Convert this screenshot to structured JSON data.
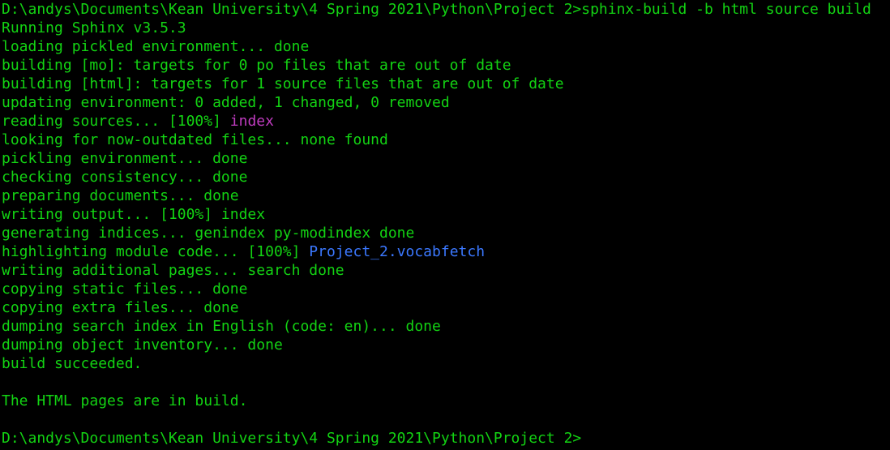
{
  "colors": {
    "background": "#000000",
    "text": "#13d313",
    "magenta": "#c03cc0",
    "blue": "#3b78ff"
  },
  "lines": [
    [
      {
        "text": "D:\\andys\\Documents\\Kean University\\4 Spring 2021\\Python\\Project 2>sphinx-build -b html source build"
      }
    ],
    [
      {
        "text": "Running Sphinx v3.5.3"
      }
    ],
    [
      {
        "text": "loading pickled environment... done"
      }
    ],
    [
      {
        "text": "building [mo]: targets for 0 po files that are out of date"
      }
    ],
    [
      {
        "text": "building [html]: targets for 1 source files that are out of date"
      }
    ],
    [
      {
        "text": "updating environment: 0 added, 1 changed, 0 removed"
      }
    ],
    [
      {
        "text": "reading sources... [100%] "
      },
      {
        "text": "index",
        "color": "magenta"
      }
    ],
    [
      {
        "text": "looking for now-outdated files... none found"
      }
    ],
    [
      {
        "text": "pickling environment... done"
      }
    ],
    [
      {
        "text": "checking consistency... done"
      }
    ],
    [
      {
        "text": "preparing documents... done"
      }
    ],
    [
      {
        "text": "writing output... [100%] index"
      }
    ],
    [
      {
        "text": "generating indices... genindex py-modindex done"
      }
    ],
    [
      {
        "text": "highlighting module code... [100%] "
      },
      {
        "text": "Project_2.vocabfetch",
        "color": "blue"
      }
    ],
    [
      {
        "text": "writing additional pages... search done"
      }
    ],
    [
      {
        "text": "copying static files... done"
      }
    ],
    [
      {
        "text": "copying extra files... done"
      }
    ],
    [
      {
        "text": "dumping search index in English (code: en)... done"
      }
    ],
    [
      {
        "text": "dumping object inventory... done"
      }
    ],
    [
      {
        "text": "build succeeded."
      }
    ],
    [
      {
        "text": ""
      }
    ],
    [
      {
        "text": "The HTML pages are in build."
      }
    ],
    [
      {
        "text": ""
      }
    ],
    [
      {
        "text": "D:\\andys\\Documents\\Kean University\\4 Spring 2021\\Python\\Project 2>"
      }
    ]
  ]
}
